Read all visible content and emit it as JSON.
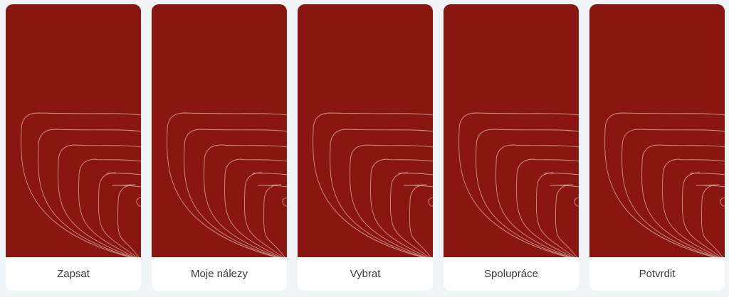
{
  "cards": [
    {
      "label": "Zapsat"
    },
    {
      "label": "Moje nálezy"
    },
    {
      "label": "Vybrat"
    },
    {
      "label": "Spolupráce"
    },
    {
      "label": "Potvrdit"
    }
  ],
  "colors": {
    "card_art": "#8a1611",
    "contour_line": "#d9a7a3",
    "label_text": "#3a3a3a",
    "page_background": "#f1f5f8"
  }
}
